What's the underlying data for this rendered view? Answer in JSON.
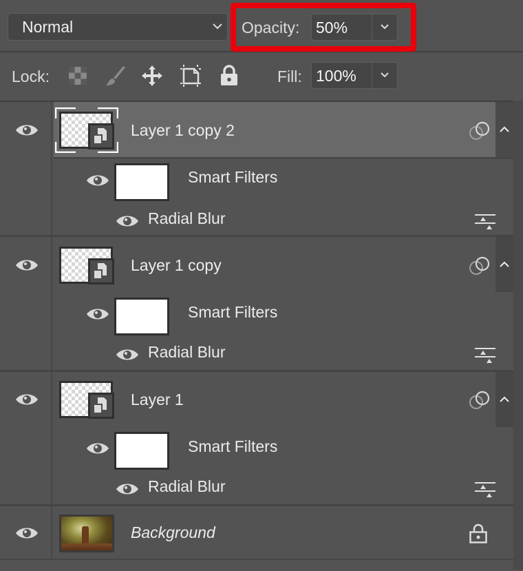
{
  "toolbar": {
    "blend_mode": "Normal",
    "opacity_label": "Opacity:",
    "opacity_value": "50%",
    "highlight_color": "#e8000a"
  },
  "lockbar": {
    "lock_label": "Lock:",
    "lock_icons": [
      "lock-transparent-pixels-icon",
      "lock-image-pixels-icon",
      "lock-position-icon",
      "lock-artboard-icon",
      "lock-all-icon"
    ],
    "fill_label": "Fill:",
    "fill_value": "100%"
  },
  "layers": [
    {
      "name": "Layer 1 copy 2",
      "selected": true,
      "type": "smart-object",
      "smart_filters_label": "Smart Filters",
      "filter": "Radial Blur"
    },
    {
      "name": "Layer 1 copy",
      "selected": false,
      "type": "smart-object",
      "smart_filters_label": "Smart Filters",
      "filter": "Radial Blur"
    },
    {
      "name": "Layer 1",
      "selected": false,
      "type": "smart-object",
      "smart_filters_label": "Smart Filters",
      "filter": "Radial Blur"
    },
    {
      "name": "Background",
      "selected": false,
      "type": "background",
      "locked": true
    }
  ],
  "colors": {
    "panel_bg": "#535353",
    "selected_row": "#696969",
    "text": "#ececec"
  }
}
